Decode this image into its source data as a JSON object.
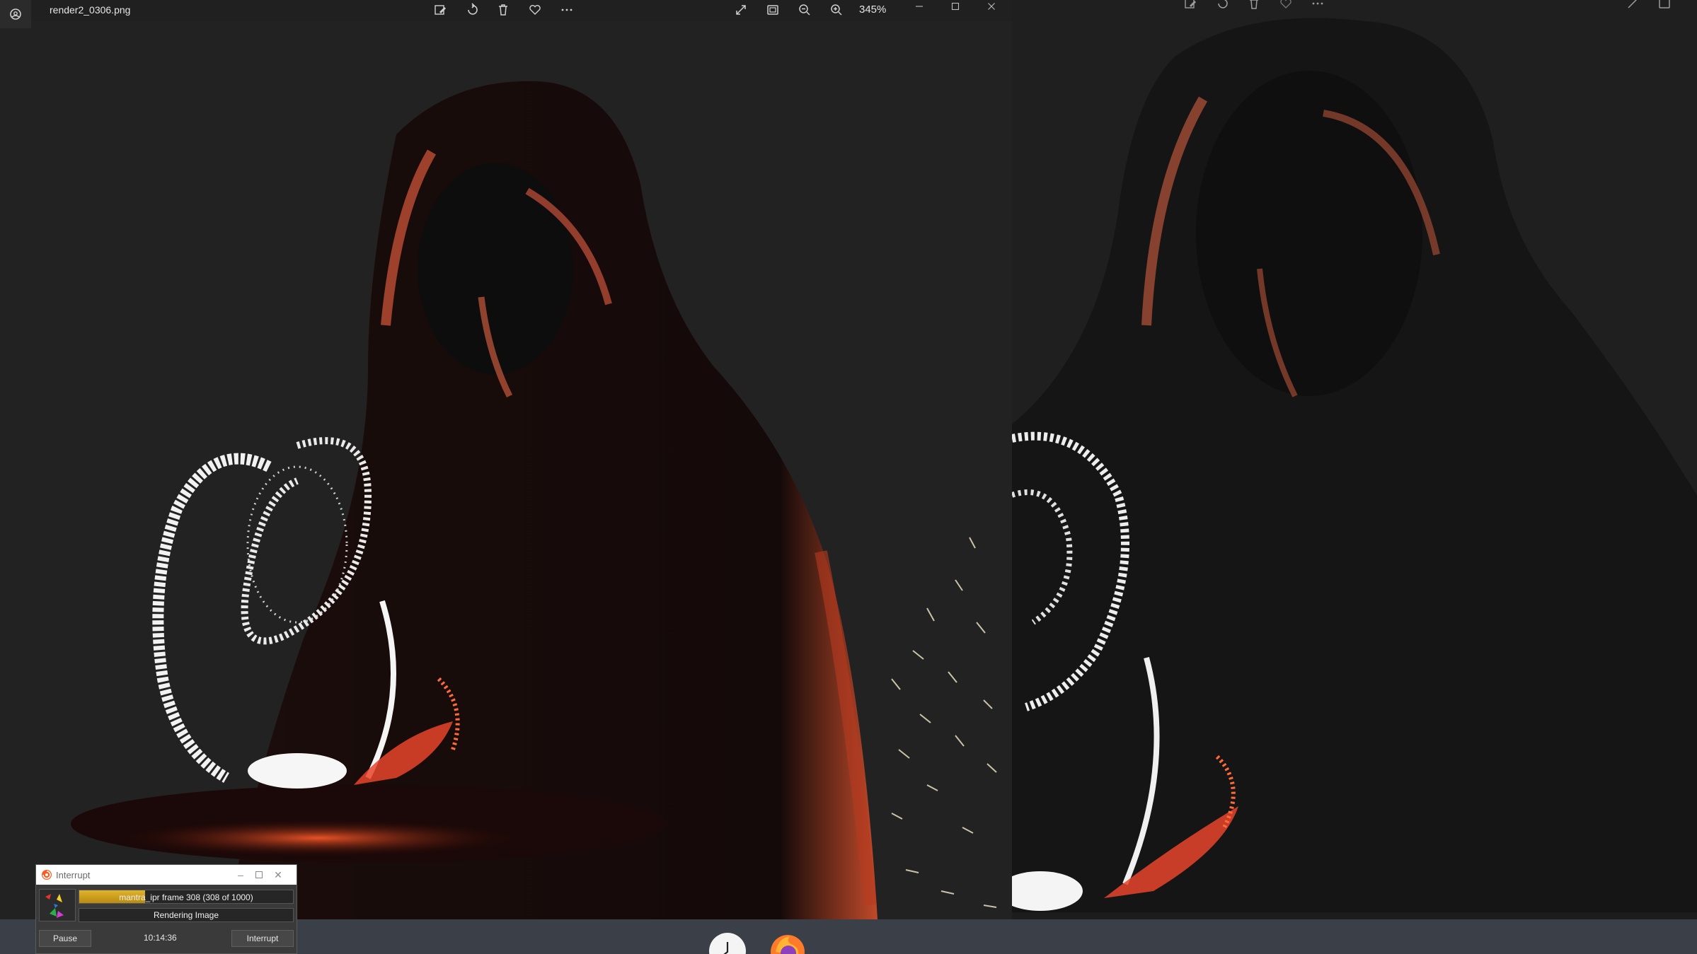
{
  "left_window": {
    "filename": "render2_0306.png",
    "zoom": "345%",
    "toolbar_icons": [
      "edit-image-icon",
      "rotate-icon",
      "delete-icon",
      "favorite-icon",
      "more-icon"
    ],
    "view_icons": [
      "expand-icon",
      "fit-window-icon",
      "zoom-out-icon",
      "zoom-in-icon"
    ]
  },
  "dialog": {
    "title": "Interrupt",
    "progress_label": "mantra_ipr frame 308 (308 of 1000)",
    "progress_fraction": 0.308,
    "status": "Rendering Image",
    "pause_label": "Pause",
    "elapsed": "10:14:36",
    "interrupt_label": "Interrupt"
  },
  "taskbar": {
    "apps": [
      "clock-app-icon",
      "firefox-icon"
    ]
  },
  "colors": {
    "accent_progress": "#e0b32a",
    "taskbar": "#3b4048",
    "canvas_bg": "#222222"
  }
}
